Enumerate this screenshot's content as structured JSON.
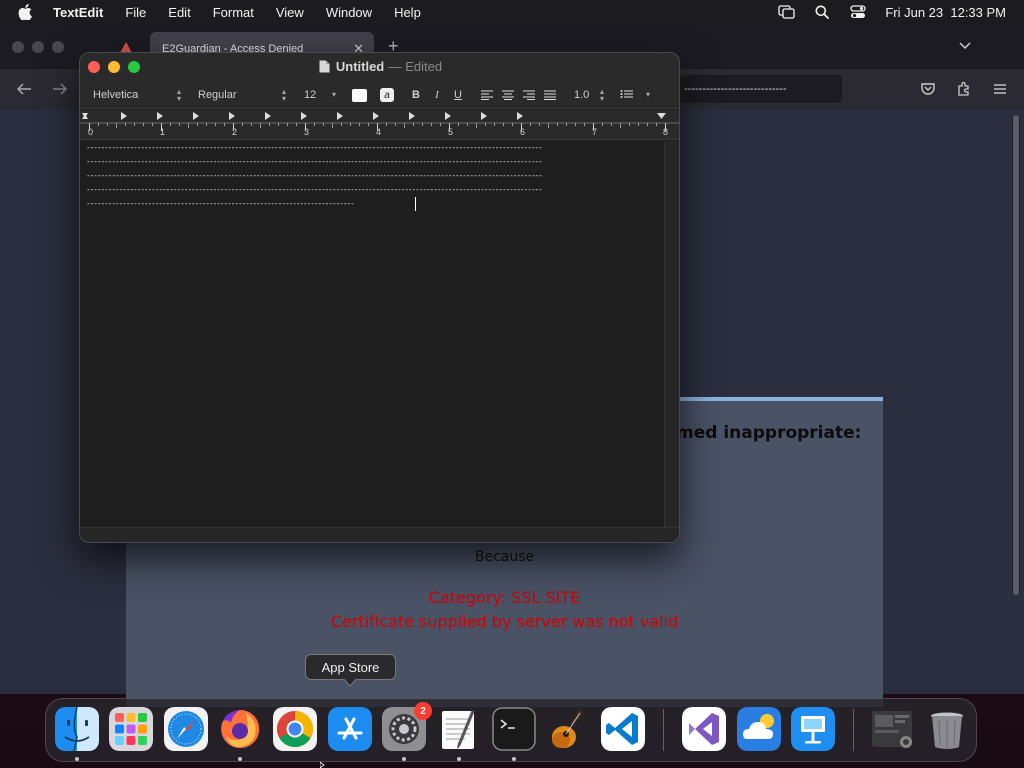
{
  "menubar": {
    "app_name": "TextEdit",
    "items": [
      "File",
      "Edit",
      "Format",
      "View",
      "Window",
      "Help"
    ],
    "clock": "Fri Jun 23  12:33 PM"
  },
  "browser": {
    "tab_title": "E2Guardian - Access Denied",
    "tab_close": "✕",
    "new_tab": "+",
    "url_text": "----------------------------",
    "page": {
      "heading_fragment": "med inappropriate:",
      "because": "Because",
      "category": "Category: SSL SITE",
      "reason": "Certificate supplied by server was not valid"
    }
  },
  "textedit": {
    "title": "Untitled",
    "separator": "—",
    "state": "Edited",
    "toolbar": {
      "font_family": "Helvetica",
      "font_style": "Regular",
      "font_size": "12",
      "bold": "B",
      "italic": "I",
      "underline": "U",
      "line_spacing": "1.0",
      "highlight_glyph": "a"
    },
    "ruler_numbers": [
      "0",
      "1",
      "2",
      "3",
      "4",
      "5",
      "6",
      "7",
      "8"
    ],
    "lines": [
      "------------------------------------------------------------------------------------------------------------------------------",
      "------------------------------------------------------------------------------------------------------------------------------",
      "------------------------------------------------------------------------------------------------------------------------------",
      "------------------------------------------------------------------------------------------------------------------------------",
      "--------------------------------------------------------------------------"
    ]
  },
  "tooltip": {
    "label": "App Store"
  },
  "dock": {
    "apps": [
      "Finder",
      "Launchpad",
      "Safari",
      "Firefox",
      "Google Chrome",
      "App Store",
      "System Preferences",
      "TextEdit",
      "Terminal",
      "GarageBand",
      "Visual Studio Code",
      "Visual Studio",
      "iCloud",
      "Keynote",
      "Downloads",
      "Trash"
    ],
    "badge_count": "2"
  }
}
